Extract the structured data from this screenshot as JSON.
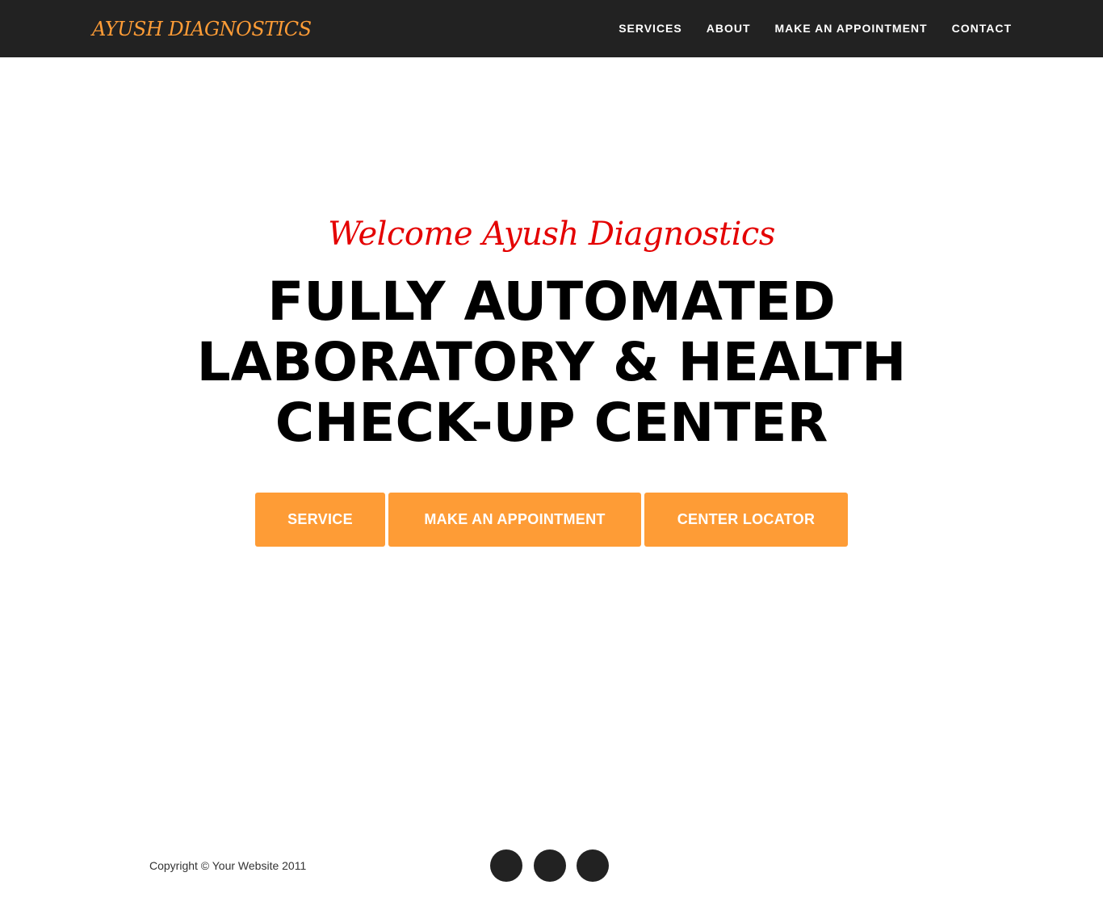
{
  "navbar": {
    "brand": "AYUSH DIAGNOSTICS",
    "links": [
      "SERVICES",
      "ABOUT",
      "MAKE AN APPOINTMENT",
      "CONTACT"
    ]
  },
  "hero": {
    "welcome": "Welcome Ayush Diagnostics",
    "headline_lines": [
      "FULLY AUTOMATED",
      "LABORATORY & HEALTH",
      "CHECK-UP CENTER"
    ],
    "buttons": [
      "SERVICE",
      "MAKE AN APPOINTMENT",
      "CENTER LOCATOR"
    ]
  },
  "footer": {
    "copyright": "Copyright © Your Website 2011"
  },
  "colors": {
    "navbar_bg": "#222222",
    "brand": "#fe9c36",
    "button_bg": "#fe9c36",
    "welcome": "#e40000",
    "headline": "#000000",
    "social_circle": "#222222"
  }
}
